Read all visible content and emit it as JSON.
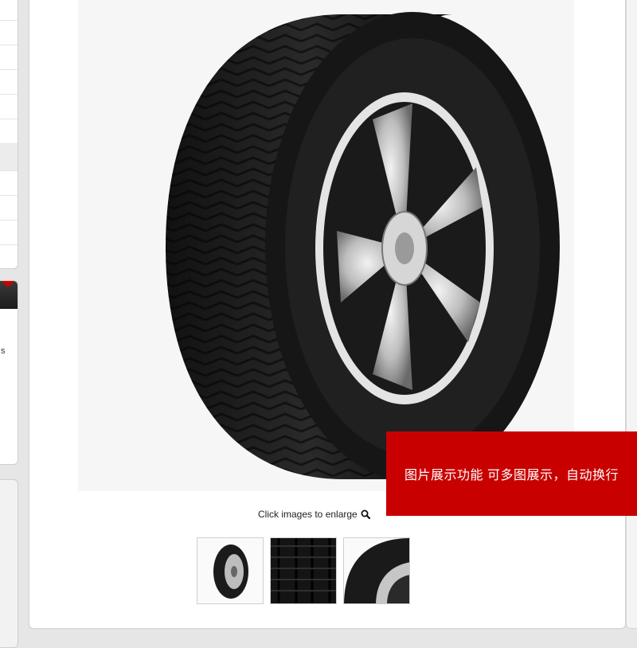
{
  "gallery": {
    "enlarge_hint": "Click images to enlarge",
    "thumbnails": [
      {
        "alt": "tire-side-view"
      },
      {
        "alt": "tire-tread-closeup"
      },
      {
        "alt": "tire-sidewall-closeup"
      }
    ]
  },
  "overlay": {
    "text": "图片展示功能 可多图展示，自动换行"
  },
  "sidebar": {
    "snippet": "s"
  },
  "colors": {
    "accent_red": "#c90000",
    "card_bg": "#ffffff",
    "page_bg": "#e6e6e6"
  },
  "icons": {
    "enlarge": "magnifier-icon"
  }
}
